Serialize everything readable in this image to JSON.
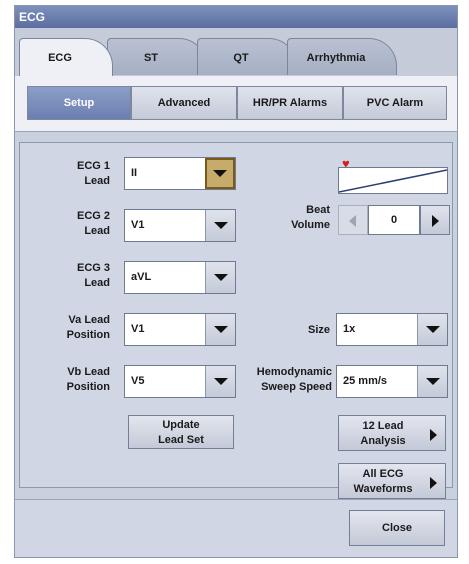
{
  "window": {
    "title": "ECG"
  },
  "tabs": [
    {
      "label": "ECG",
      "active": true
    },
    {
      "label": "ST",
      "active": false
    },
    {
      "label": "QT",
      "active": false
    },
    {
      "label": "Arrhythmia",
      "active": false
    }
  ],
  "subtabs": [
    {
      "label": "Setup",
      "active": true
    },
    {
      "label": "Advanced",
      "active": false
    },
    {
      "label": "HR/PR Alarms",
      "active": false
    },
    {
      "label": "PVC Alarm",
      "active": false
    }
  ],
  "leads": {
    "ecg1": {
      "label_line1": "ECG 1",
      "label_line2": "Lead",
      "value": "II"
    },
    "ecg2": {
      "label_line1": "ECG 2",
      "label_line2": "Lead",
      "value": "V1"
    },
    "ecg3": {
      "label_line1": "ECG 3",
      "label_line2": "Lead",
      "value": "aVL"
    },
    "va": {
      "label_line1": "Va Lead",
      "label_line2": "Position",
      "value": "V1"
    },
    "vb": {
      "label_line1": "Vb Lead",
      "label_line2": "Position",
      "value": "V5"
    }
  },
  "update_button": {
    "line1": "Update",
    "line2": "Lead Set"
  },
  "beat_volume": {
    "label_line1": "Beat",
    "label_line2": "Volume",
    "value": "0",
    "heart_icon": "heart-icon"
  },
  "size": {
    "label": "Size",
    "value": "1x"
  },
  "sweep": {
    "label_line1": "Hemodynamic",
    "label_line2": "Sweep Speed",
    "value": "25 mm/s"
  },
  "lead12_button": {
    "line1": "12 Lead",
    "line2": "Analysis"
  },
  "allecg_button": {
    "line1": "All ECG",
    "line2": "Waveforms"
  },
  "close_button": {
    "label": "Close"
  },
  "colors": {
    "titlebar": "#6a7db0",
    "active_subtab": "#7b8fbf",
    "focus": "#c6ab6a",
    "heart": "#d42020"
  }
}
